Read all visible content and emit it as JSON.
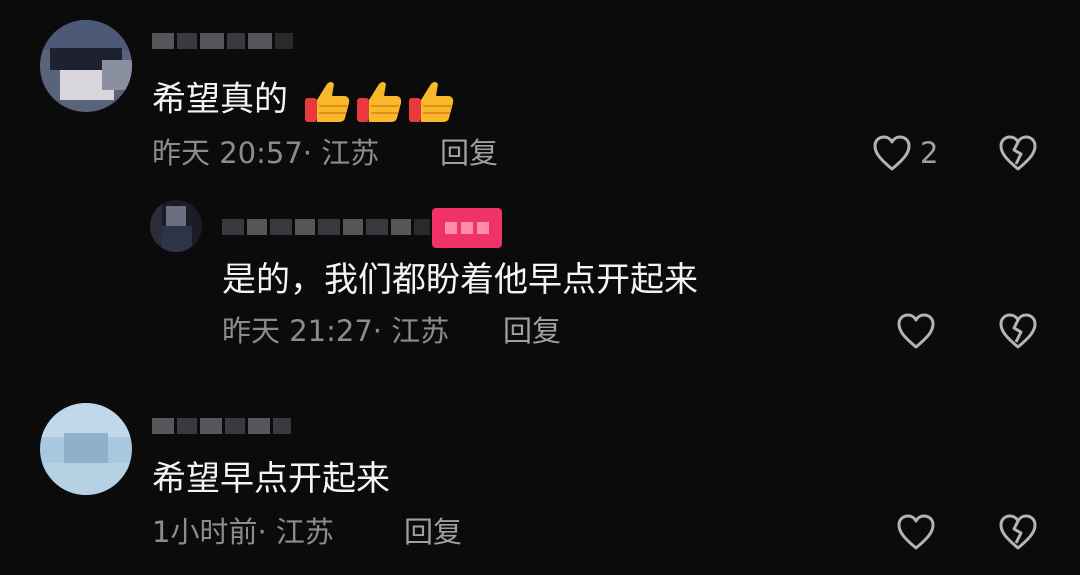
{
  "comments": [
    {
      "text": "希望真的",
      "emoji": [
        "thumbs-up",
        "thumbs-up",
        "thumbs-up"
      ],
      "time": "昨天 20:57",
      "location": "· 江苏",
      "reply_label": "回复",
      "like_count": "2"
    },
    {
      "text": "是的，我们都盼着他早点开起来",
      "time": "昨天 21:27",
      "location": "· 江苏",
      "reply_label": "回复",
      "like_count": ""
    },
    {
      "text": "希望早点开起来",
      "time": "1小时前",
      "location": "· 江苏",
      "reply_label": "回复",
      "like_count": ""
    }
  ],
  "colors": {
    "background": "#0b0b0c",
    "badge": "#f0326a",
    "meta_text": "#8c8c8e"
  },
  "icons": {
    "like": "heart-outline-icon",
    "dislike": "broken-heart-icon",
    "emoji": "thumbs-up-emoji"
  }
}
